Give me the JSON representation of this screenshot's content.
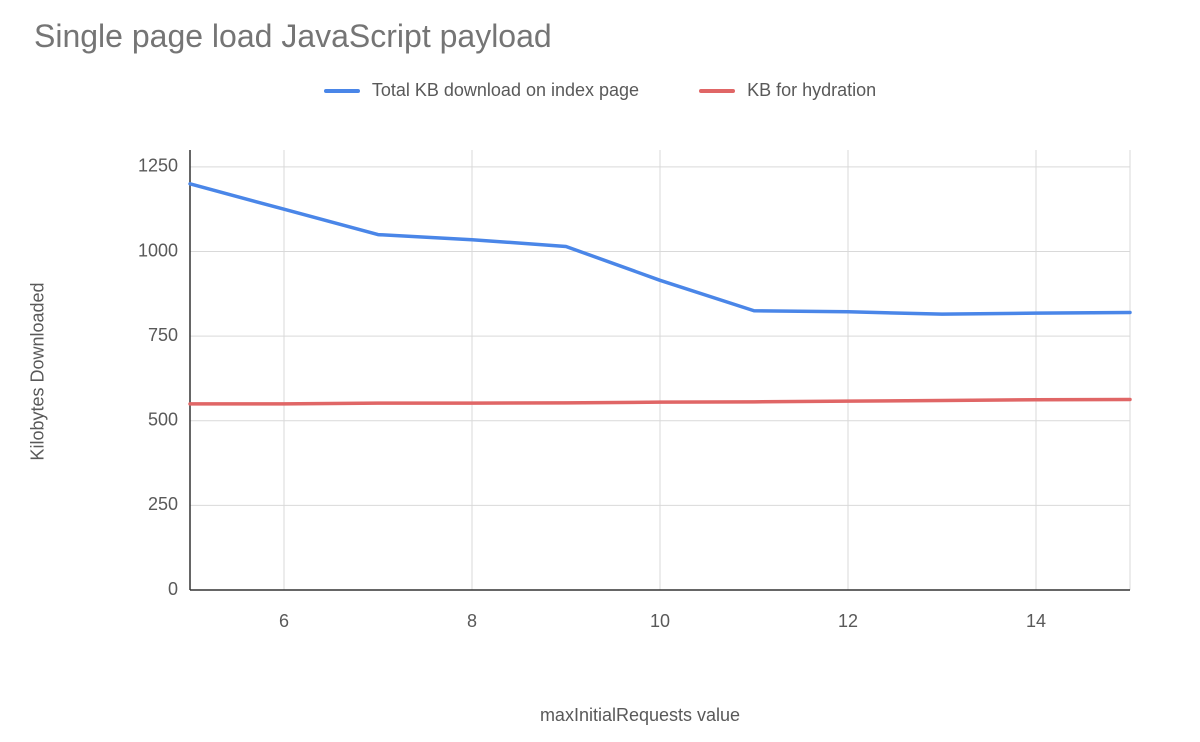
{
  "chart_data": {
    "type": "line",
    "title": "Single page load JavaScript payload",
    "xlabel": "maxInitialRequests value",
    "ylabel": "Kilobytes Downloaded",
    "x": [
      5,
      6,
      7,
      8,
      9,
      10,
      11,
      12,
      13,
      14,
      15
    ],
    "x_ticks": [
      6,
      8,
      10,
      12,
      14
    ],
    "xlim": [
      5,
      15
    ],
    "y_ticks": [
      0,
      250,
      500,
      750,
      1000,
      1250
    ],
    "ylim": [
      0,
      1300
    ],
    "grid": true,
    "legend_position": "top",
    "series": [
      {
        "name": "Total KB download on index page",
        "color": "#4a86e8",
        "values": [
          1200,
          1125,
          1050,
          1035,
          1015,
          915,
          825,
          822,
          815,
          818,
          820
        ]
      },
      {
        "name": "KB for hydration",
        "color": "#e06666",
        "values": [
          550,
          550,
          552,
          552,
          553,
          555,
          556,
          558,
          560,
          562,
          563
        ]
      }
    ]
  }
}
